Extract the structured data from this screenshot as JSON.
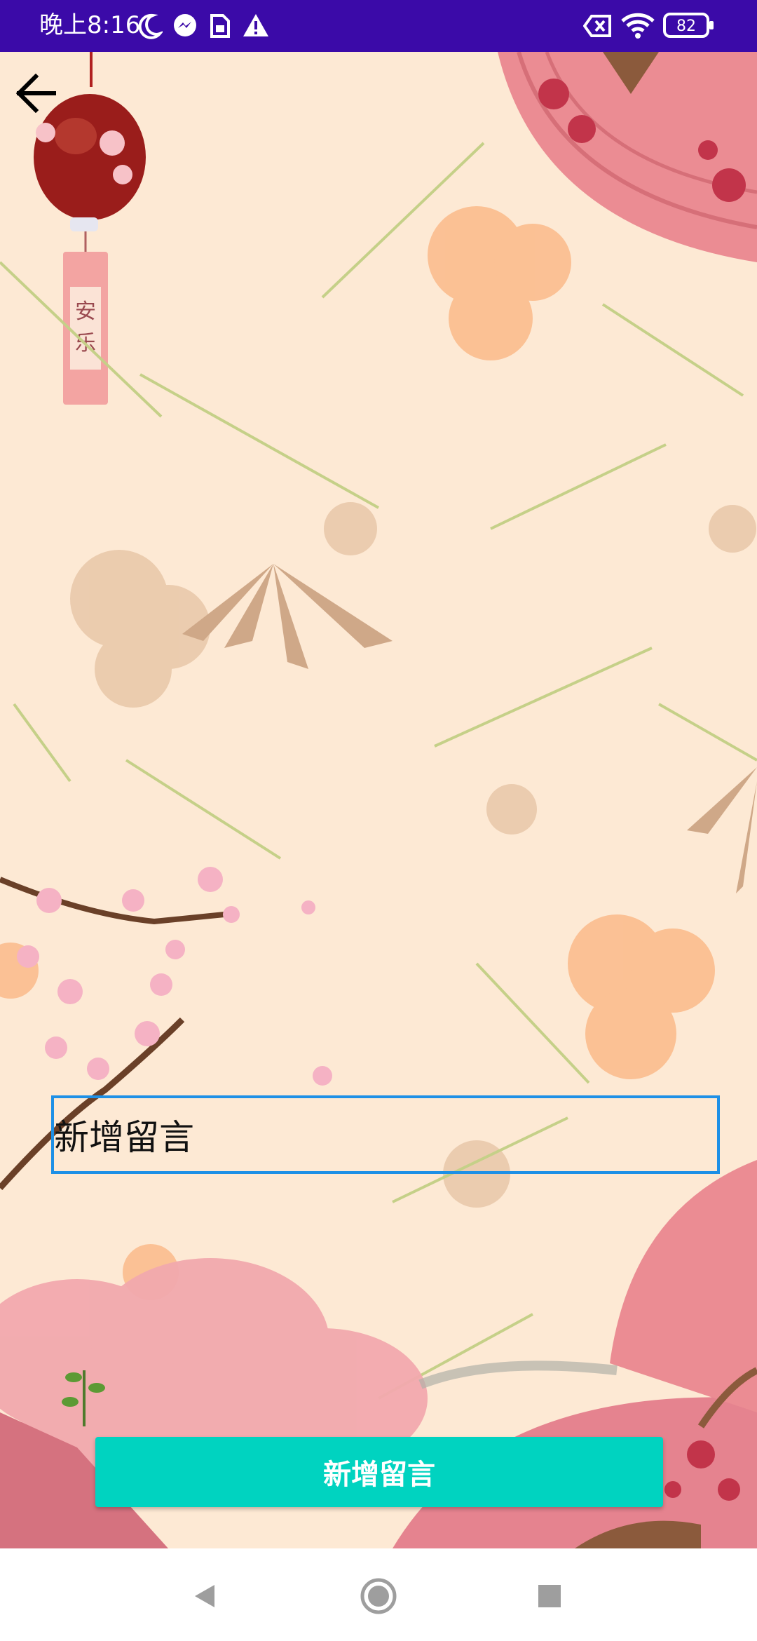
{
  "status_bar": {
    "time": "晚上8:16",
    "battery": "82",
    "icons": [
      "moon-icon",
      "messenger-icon",
      "sim-icon",
      "warning-icon",
      "no-sim-icon",
      "wifi-icon",
      "battery-icon"
    ]
  },
  "toolbar": {
    "back_icon": "arrow-left-icon"
  },
  "form": {
    "message_input_value": "新增留言",
    "submit_label": "新增留言"
  },
  "colors": {
    "status_bar": "#3b0aa8",
    "background": "#fde9d4",
    "input_border": "#1e90e6",
    "button": "#00d3c0"
  },
  "nav_bar": {
    "icons": [
      "back-triangle-icon",
      "home-circle-icon",
      "recents-square-icon"
    ]
  }
}
